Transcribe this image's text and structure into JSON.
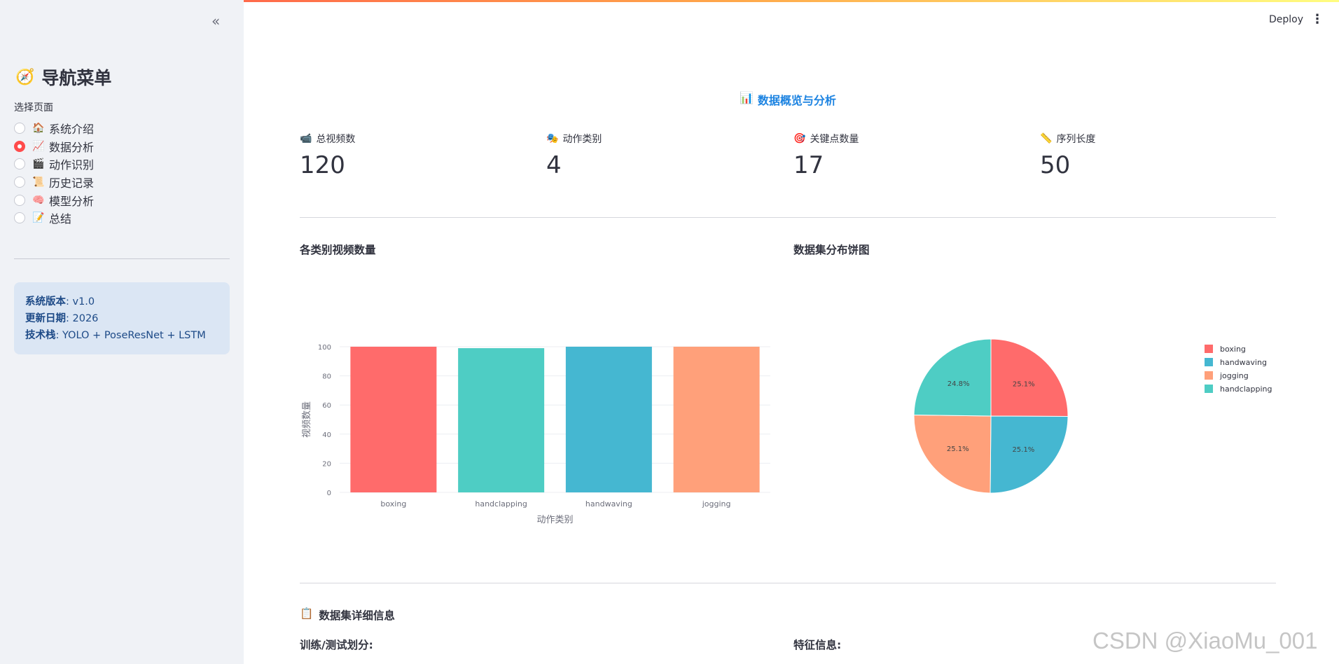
{
  "sidebar": {
    "collapse_icon": "«",
    "title": "导航菜单",
    "title_icon": "🧭",
    "radio_label": "选择页面",
    "items": [
      {
        "icon": "🏠",
        "label": "系统介绍",
        "selected": false
      },
      {
        "icon": "📈",
        "label": "数据分析",
        "selected": true
      },
      {
        "icon": "🎬",
        "label": "动作识别",
        "selected": false
      },
      {
        "icon": "📜",
        "label": "历史记录",
        "selected": false
      },
      {
        "icon": "🧠",
        "label": "模型分析",
        "selected": false
      },
      {
        "icon": "📝",
        "label": "总结",
        "selected": false
      }
    ],
    "info": {
      "version_key": "系统版本",
      "version_val": ": v1.0",
      "date_key": "更新日期",
      "date_val": ": 2026",
      "stack_key": "技术栈",
      "stack_val": ": YOLO + PoseResNet + LSTM"
    }
  },
  "header": {
    "deploy": "Deploy",
    "menu_icon": "⋮"
  },
  "main": {
    "title_icon": "📊",
    "title": "数据概览与分析",
    "metrics": [
      {
        "icon": "📹",
        "label": "总视频数",
        "value": "120"
      },
      {
        "icon": "🎭",
        "label": "动作类别",
        "value": "4"
      },
      {
        "icon": "🎯",
        "label": "关键点数量",
        "value": "17"
      },
      {
        "icon": "📏",
        "label": "序列长度",
        "value": "50"
      }
    ],
    "bar_title": "各类别视频数量",
    "pie_title": "数据集分布饼图",
    "detail_icon": "📋",
    "detail_title": "数据集详细信息",
    "split_title": "训练/测试划分:",
    "feature_title": "特征信息:"
  },
  "chart_data": [
    {
      "type": "bar",
      "categories": [
        "boxing",
        "handclapping",
        "handwaving",
        "jogging"
      ],
      "values": [
        100,
        99,
        100,
        100
      ],
      "colors": [
        "#ff6b6b",
        "#4ecdc4",
        "#45b7d1",
        "#ffa07a"
      ],
      "xlabel": "动作类别",
      "ylabel": "视频数量",
      "ylim": [
        0,
        100
      ],
      "yticks": [
        0,
        20,
        40,
        60,
        80,
        100
      ]
    },
    {
      "type": "pie",
      "labels": [
        "boxing",
        "handwaving",
        "jogging",
        "handclapping"
      ],
      "values": [
        25.1,
        25.1,
        25.1,
        24.8
      ],
      "value_labels": [
        "25.1%",
        "25.1%",
        "25.1%",
        "24.8%"
      ],
      "colors": [
        "#ff6b6b",
        "#45b7d1",
        "#ffa07a",
        "#4ecdc4"
      ],
      "legend": "right"
    }
  ],
  "watermark": "CSDN @XiaoMu_001"
}
